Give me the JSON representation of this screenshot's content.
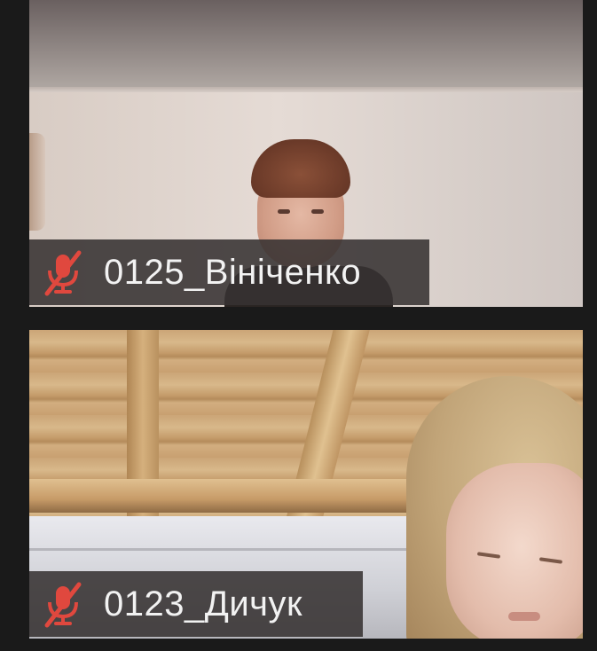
{
  "participants": [
    {
      "name": "0125_Вініченко",
      "muted": true,
      "icon": "muted-microphone-icon"
    },
    {
      "name": "0123_Дичук",
      "muted": true,
      "icon": "muted-microphone-icon"
    }
  ],
  "colors": {
    "background": "#1a1a1a",
    "label_background": "#373232",
    "muted_icon": "#e0483e",
    "label_text": "#f2f2f2"
  }
}
